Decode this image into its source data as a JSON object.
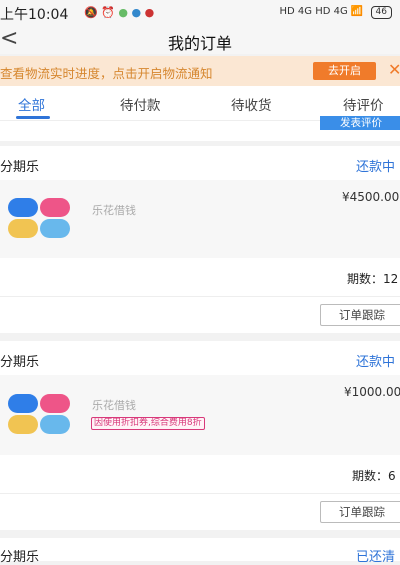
{
  "status_bar": {
    "time": "上午10:04",
    "icons": [
      "bell-off-icon",
      "alarm-icon",
      "wechat-icon",
      "qq-icon",
      "netease-icon"
    ],
    "signal_text": "HD 4G HD 4G",
    "battery": "46"
  },
  "nav": {
    "back_icon": "chevron-left-icon",
    "title": "我的订单"
  },
  "banner": {
    "text": "查看物流实时进度，点击开启物流通知",
    "button": "去开启",
    "close_icon": "close-icon"
  },
  "tabs": [
    {
      "label": "全部",
      "active": true
    },
    {
      "label": "待付款",
      "active": false
    },
    {
      "label": "待收货",
      "active": false
    },
    {
      "label": "待评价",
      "active": false
    }
  ],
  "prev_card_button": "发表评价",
  "orders": [
    {
      "shop": "分期乐",
      "status": "还款中",
      "product": "乐花借钱",
      "price": "¥4500.00",
      "tag": "",
      "periods": "期数：12",
      "action": "订单跟踪"
    },
    {
      "shop": "分期乐",
      "status": "还款中",
      "product": "乐花借钱",
      "price": "¥1000.00",
      "tag": "因使用折扣券,综合费用8折",
      "periods": "期数：6",
      "action": "订单跟踪"
    },
    {
      "shop": "分期乐",
      "status": "已还清"
    }
  ],
  "colors": {
    "accent": "#2f74d8",
    "banner_bg": "#fbe7d3",
    "banner_button": "#f07b2a",
    "tag": "#d8397a"
  }
}
